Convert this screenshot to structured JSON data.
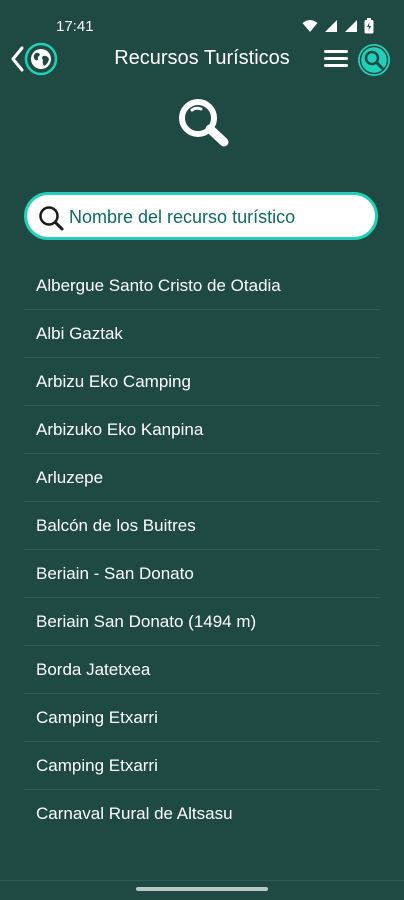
{
  "status_bar": {
    "time": "17:41",
    "icons": [
      "wifi-icon",
      "signal-icon",
      "signal-icon",
      "battery-icon"
    ]
  },
  "app_bar": {
    "title": "Recursos Turísticos",
    "icons": [
      "back-chevron-icon",
      "globe-icon",
      "menu-icon",
      "search-icon"
    ]
  },
  "search": {
    "placeholder": "Nombre del recurso turístico",
    "value": ""
  },
  "results": [
    "Albergue Santo Cristo de Otadia",
    "Albi Gaztak",
    "Arbizu Eko Camping",
    "Arbizuko Eko Kanpina",
    "Arluzepe",
    "Balcón de los Buitres",
    "Beriain - San Donato",
    "Beriain San Donato (1494 m)",
    "Borda Jatetxea",
    "Camping Etxarri",
    "Camping Etxarri",
    "Carnaval Rural de Altsasu"
  ],
  "colors": {
    "background": "#1f4a44",
    "accent": "#20d0b8",
    "placeholder_text": "#0d6b63"
  }
}
